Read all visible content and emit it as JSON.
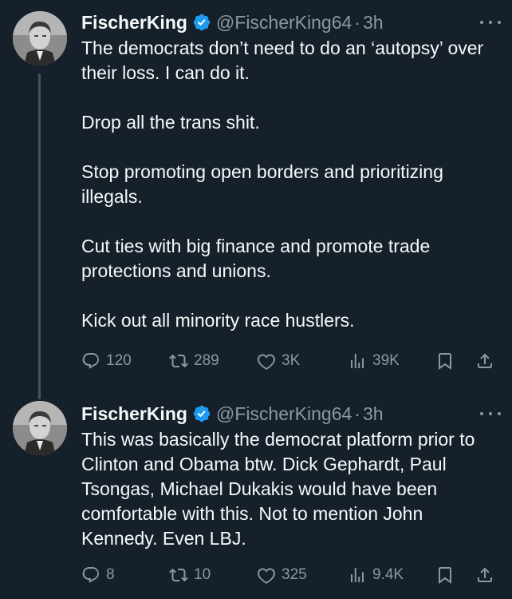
{
  "tweets": [
    {
      "author": {
        "display_name": "FischerKing",
        "handle": "@FischerKing64",
        "verified": true
      },
      "separator": "·",
      "time": "3h",
      "paragraphs": [
        "The democrats don’t need to do an ‘autopsy’ over their loss. I can do it.",
        "Drop all the trans shit.",
        "Stop promoting open borders and prioritizing illegals.",
        "Cut ties with big finance and promote trade protections and unions.",
        "Kick out all minority race hustlers."
      ],
      "stats": {
        "replies": "120",
        "reposts": "289",
        "likes": "3K",
        "views": "39K"
      }
    },
    {
      "author": {
        "display_name": "FischerKing",
        "handle": "@FischerKing64",
        "verified": true
      },
      "separator": "·",
      "time": "3h",
      "paragraphs": [
        "This was basically the democrat platform prior to Clinton and Obama btw. Dick Gephardt, Paul Tsongas, Michael Dukakis would have been comfortable with this. Not to mention John Kennedy. Even LBJ."
      ],
      "stats": {
        "replies": "8",
        "reposts": "10",
        "likes": "325",
        "views": "9.4K"
      }
    }
  ],
  "colors": {
    "background": "#15202b",
    "text": "#f7f9f9",
    "secondary_text": "#8b98a5",
    "verified_badge": "#1d9bf0",
    "thread_line": "#425364"
  },
  "icons": {
    "verified": "verified-badge-icon",
    "more": "more-options-icon",
    "reply": "reply-icon",
    "repost": "repost-icon",
    "like": "heart-icon",
    "views": "views-chart-icon",
    "bookmark": "bookmark-icon",
    "share": "share-icon"
  }
}
